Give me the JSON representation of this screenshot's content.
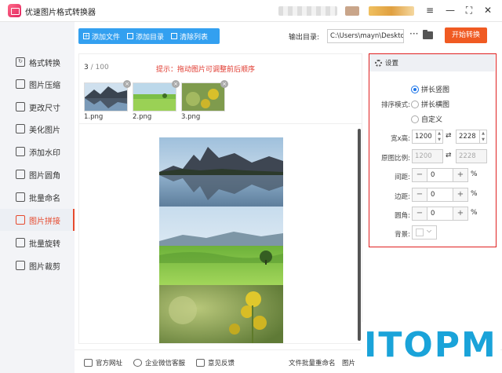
{
  "app": {
    "title": "优速图片格式转换器"
  },
  "sidebar": {
    "items": [
      {
        "label": "格式转换",
        "icon": "format-icon",
        "active": false
      },
      {
        "label": "图片压缩",
        "icon": "compress-icon",
        "active": false
      },
      {
        "label": "更改尺寸",
        "icon": "resize-icon",
        "active": false
      },
      {
        "label": "美化图片",
        "icon": "beautify-icon",
        "active": false
      },
      {
        "label": "添加水印",
        "icon": "watermark-icon",
        "active": false
      },
      {
        "label": "图片圆角",
        "icon": "round-corner-icon",
        "active": false
      },
      {
        "label": "批量命名",
        "icon": "rename-icon",
        "active": false
      },
      {
        "label": "图片拼接",
        "icon": "stitch-icon",
        "active": true
      },
      {
        "label": "批量旋转",
        "icon": "rotate-icon",
        "active": false
      },
      {
        "label": "图片裁剪",
        "icon": "crop-icon",
        "active": false
      }
    ]
  },
  "toolbar": {
    "add_file": "添加文件",
    "add_dir": "添加目录",
    "clear_list": "清除列表"
  },
  "output": {
    "label": "输出目录:",
    "path": "C:\\Users\\mayn\\Desktop",
    "more": "···",
    "start": "开始转换"
  },
  "files": {
    "current": "3",
    "sep": " / ",
    "total": "100",
    "hint": "提示：拖动图片可调整前后顺序",
    "items": [
      {
        "name": "1.png"
      },
      {
        "name": "2.png"
      },
      {
        "name": "3.png"
      }
    ]
  },
  "settings": {
    "title": "设置",
    "mode_label": "排序模式:",
    "modes": [
      {
        "label": "拼长竖图",
        "selected": true
      },
      {
        "label": "拼长横图",
        "selected": false
      },
      {
        "label": "自定义",
        "selected": false
      }
    ],
    "size_label": "宽x高:",
    "width": "1200",
    "height": "2228",
    "ratio_label": "原图比例:",
    "ratio_w": "1200",
    "ratio_h": "2228",
    "spacing_label": "间距:",
    "spacing": "0",
    "border_label": "边距:",
    "border": "0",
    "radius_label": "圆角:",
    "radius": "0",
    "bg_label": "背景:",
    "percent": "%",
    "swap": "⇄"
  },
  "footer": {
    "links": [
      "官方网址",
      "企业微信客服",
      "意见反馈",
      "文件批量重命名",
      "图片"
    ]
  },
  "watermark": {
    "text": "ITOPM"
  },
  "colors": {
    "accent": "#e64a2e",
    "toolbar": "#33a0f0",
    "start": "#f05a22",
    "hint": "#e03a2f",
    "panel_border": "#e02020",
    "watermark": "#1aa3d9"
  }
}
